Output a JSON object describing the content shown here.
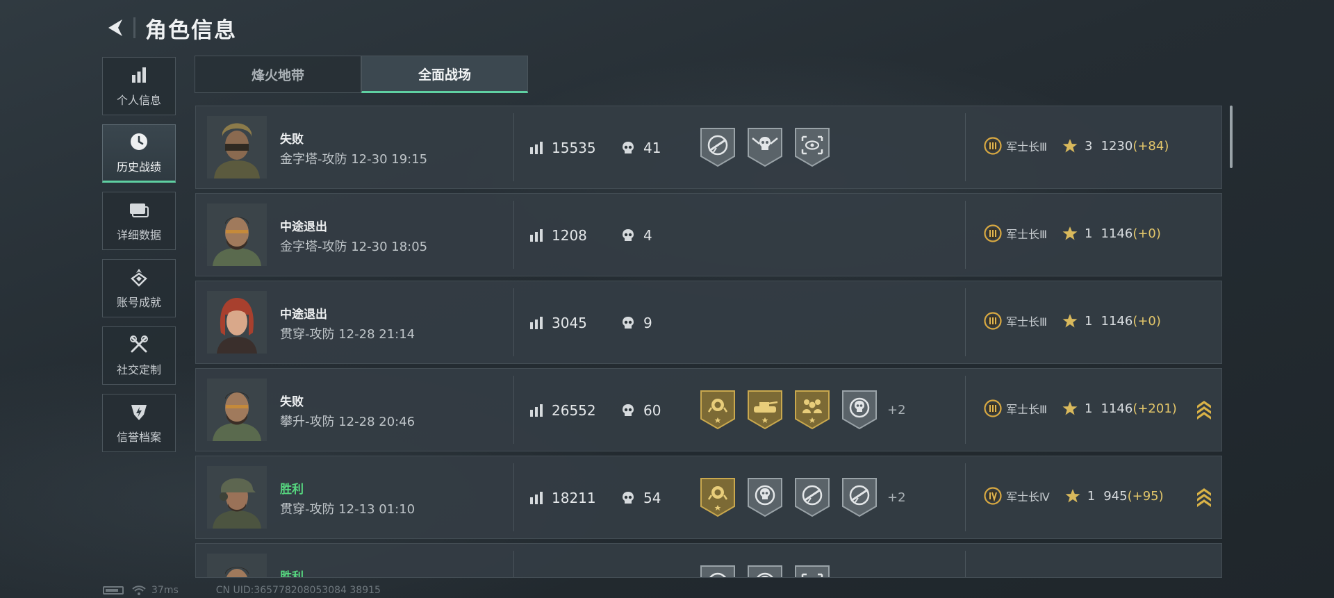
{
  "header": {
    "title": "角色信息",
    "back_icon": "back-arrow-icon"
  },
  "sidebar": {
    "items": [
      {
        "label": "个人信息",
        "icon": "bar-chart-icon",
        "active": false
      },
      {
        "label": "历史战绩",
        "icon": "clock-icon",
        "active": true
      },
      {
        "label": "详细数据",
        "icon": "cards-icon",
        "active": false
      },
      {
        "label": "账号成就",
        "icon": "achievement-icon",
        "active": false
      },
      {
        "label": "社交定制",
        "icon": "tools-icon",
        "active": false
      },
      {
        "label": "信誉档案",
        "icon": "shield-icon",
        "active": false
      }
    ]
  },
  "tabs": [
    {
      "label": "烽火地带",
      "active": false
    },
    {
      "label": "全面战场",
      "active": true
    }
  ],
  "matches": [
    {
      "result": "失败",
      "win": false,
      "map": "金字塔-攻防 12-30 19:15",
      "score": "15535",
      "kills": "41",
      "badges": [
        "weapon-medal-icon",
        "skull-medal-icon",
        "eye-medal-icon"
      ],
      "more": "",
      "rank_icon": "rank-iii-icon",
      "rank": "军士长Ⅲ",
      "stars": "3",
      "elo": "1230",
      "elo_delta": "(+84)",
      "promo": false
    },
    {
      "result": "中途退出",
      "win": false,
      "map": "金字塔-攻防 12-30 18:05",
      "score": "1208",
      "kills": "4",
      "badges": [],
      "more": "",
      "rank_icon": "rank-iii-icon",
      "rank": "军士长Ⅲ",
      "stars": "1",
      "elo": "1146",
      "elo_delta": "(+0)",
      "promo": false
    },
    {
      "result": "中途退出",
      "win": false,
      "map": "贯穿-攻防 12-28 21:14",
      "score": "3045",
      "kills": "9",
      "badges": [],
      "more": "",
      "rank_icon": "rank-iii-icon",
      "rank": "军士长Ⅲ",
      "stars": "1",
      "elo": "1146",
      "elo_delta": "(+0)",
      "promo": false
    },
    {
      "result": "失败",
      "win": false,
      "map": "攀升-攻防 12-28 20:46",
      "score": "26552",
      "kills": "60",
      "badges": [
        "gold-rose-medal-icon",
        "gold-tank-medal-icon",
        "gold-squad-medal-icon",
        "skull-medal-icon"
      ],
      "more": "+2",
      "rank_icon": "rank-iii-icon",
      "rank": "军士长Ⅲ",
      "stars": "1",
      "elo": "1146",
      "elo_delta": "(+201)",
      "promo": true
    },
    {
      "result": "胜利",
      "win": true,
      "map": "贯穿-攻防 12-13 01:10",
      "score": "18211",
      "kills": "54",
      "badges": [
        "gold-rose-medal-icon",
        "skull-medal-icon",
        "weapon-medal-icon",
        "weapon-medal-icon"
      ],
      "more": "+2",
      "rank_icon": "rank-iv-icon",
      "rank": "军士长Ⅳ",
      "stars": "1",
      "elo": "945",
      "elo_delta": "(+95)",
      "promo": true
    },
    {
      "result": "胜利",
      "win": true,
      "map": "",
      "score": "",
      "kills": "",
      "badges": [
        "silver-medal-icon",
        "silver-medal-icon",
        "silver-medal-icon"
      ],
      "more": "",
      "rank_icon": "",
      "rank": "",
      "stars": "",
      "elo": "",
      "elo_delta": "",
      "promo": false
    }
  ],
  "footer": {
    "ping": "37ms",
    "uid": "CN UID:365778208053084 38915"
  }
}
